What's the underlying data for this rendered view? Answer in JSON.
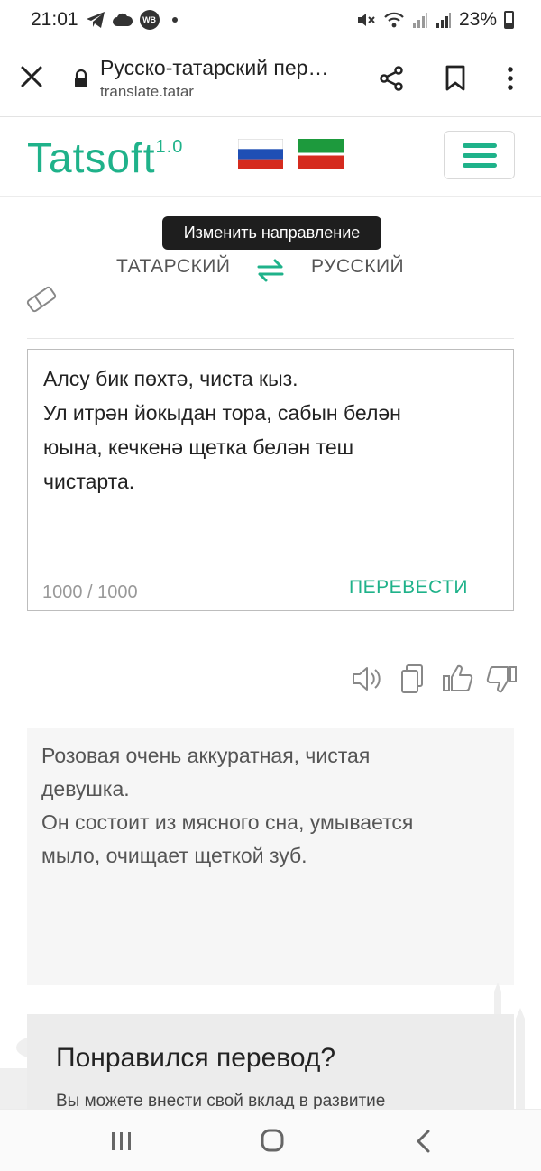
{
  "status_bar": {
    "time": "21:01",
    "badge": "WB",
    "battery": "23%",
    "icons": [
      "telegram-icon",
      "cloud-icon",
      "wb-icon",
      "dot-icon",
      "mute-icon",
      "wifi-icon",
      "signal-icon",
      "signal-icon",
      "battery-icon"
    ]
  },
  "browser": {
    "page_title": "Русско-татарский пер…",
    "url": "translate.tatar",
    "icons": [
      "close-icon",
      "lock-icon",
      "share-icon",
      "bookmark-icon",
      "more-icon"
    ]
  },
  "site_header": {
    "logo": "Tatsoft",
    "logo_version": "1.0",
    "flags": [
      "russia-flag",
      "tatarstan-flag"
    ],
    "menu_icon": "hamburger-icon"
  },
  "direction": {
    "tooltip": "Изменить направление",
    "source_lang": "ТАТАРСКИЙ",
    "target_lang": "РУССКИЙ"
  },
  "input": {
    "lines": [
      "Алсу бик пөхтә, чиста кыз.",
      "Ул итрән йокыдан тора, сабын белән",
      "юына, кечкенә щетка белән теш",
      "чистарта."
    ],
    "counter": "1000 / 1000",
    "translate_label": "ПЕРЕВЕСТИ"
  },
  "output": {
    "lines": [
      "Розовая очень аккуратная, чистая",
      "девушка.",
      "Он состоит из мясного сна, умывается",
      "мыло, очищает щеткой зуб."
    ],
    "action_icons": [
      "speaker-icon",
      "copy-icon",
      "thumbs-up-icon",
      "thumbs-down-icon"
    ]
  },
  "promo": {
    "title": "Понравился перевод?",
    "text": "Вы можете внести свой вклад в развитие"
  },
  "nav": {
    "icons": [
      "recents-icon",
      "home-icon",
      "back-icon"
    ]
  },
  "colors": {
    "accent": "#1fb28a",
    "tooltip_bg": "#1e1e1e",
    "output_bg": "#f6f6f6"
  }
}
